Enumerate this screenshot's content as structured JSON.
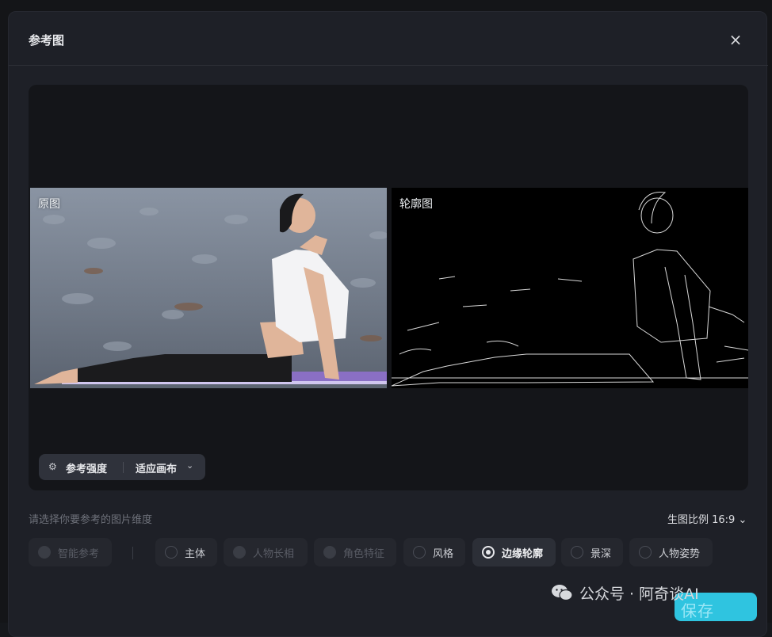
{
  "modal": {
    "title": "参考图",
    "close_icon": "×"
  },
  "preview": {
    "original_label": "原图",
    "contour_label": "轮廓图",
    "toolbar": {
      "settings_icon": "⚙",
      "strength_label": "参考强度",
      "fit_label": "适应画布",
      "chevron": "⌄"
    }
  },
  "dimension": {
    "hint": "请选择你要参考的图片维度",
    "ratio_label": "生图比例 16:9 ⌄"
  },
  "chips": [
    {
      "label": "智能参考",
      "state": "disabled"
    },
    {
      "label": "主体",
      "state": "enabled"
    },
    {
      "label": "人物长相",
      "state": "disabled"
    },
    {
      "label": "角色特征",
      "state": "disabled"
    },
    {
      "label": "风格",
      "state": "enabled"
    },
    {
      "label": "边缘轮廓",
      "state": "selected"
    },
    {
      "label": "景深",
      "state": "enabled"
    },
    {
      "label": "人物姿势",
      "state": "enabled"
    }
  ],
  "watermark": {
    "text": "公众号 · 阿奇谈AI",
    "icon": "wechat-icon"
  },
  "submit": {
    "label": "保存"
  },
  "colors": {
    "accent": "#2fc4e0",
    "modal_bg": "#1e2027",
    "preview_bg": "#141519"
  }
}
